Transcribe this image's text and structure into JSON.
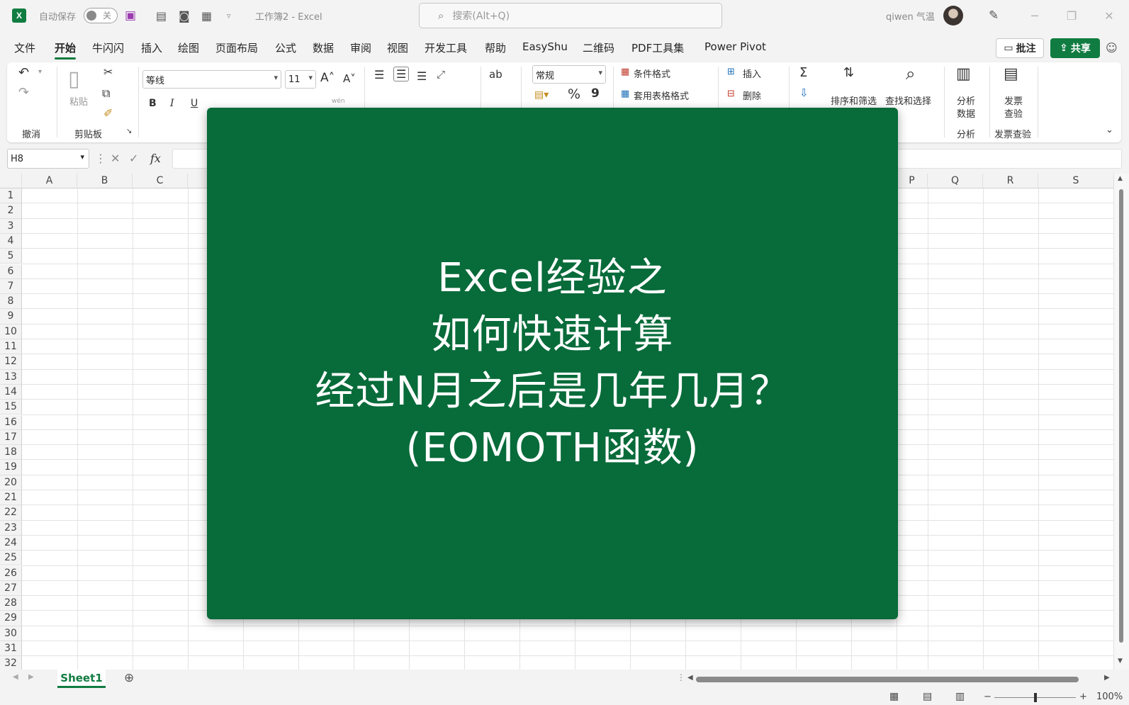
{
  "titlebar": {
    "autosave_label": "自动保存",
    "autosave_state": "关",
    "doc_title": "工作簿2 - Excel",
    "search_placeholder": "搜索(Alt+Q)",
    "user_name": "qiwen 气温",
    "logo_letter": "X"
  },
  "menu": {
    "tabs": [
      "文件",
      "开始",
      "牛闪闪",
      "插入",
      "绘图",
      "页面布局",
      "公式",
      "数据",
      "审阅",
      "视图",
      "开发工具",
      "帮助",
      "EasyShu",
      "二维码",
      "PDF工具集",
      "Power Pivot"
    ],
    "active_tab": "开始",
    "comments_label": "批注",
    "share_label": "共享"
  },
  "ribbon": {
    "undo_group": "撤消",
    "paste_label": "粘贴",
    "clipboard_group": "剪贴板",
    "font_name": "等线",
    "font_size": "11",
    "bold": "B",
    "italic": "I",
    "underline": "U",
    "number_format": "常规",
    "percent": "%",
    "comma": "9",
    "conditional_format": "条件格式",
    "table_format": "套用表格格式",
    "insert_label": "插入",
    "delete_label": "删除",
    "sort_filter": "排序和筛选",
    "find_select": "查找和选择",
    "analyze_data_line1": "分析",
    "analyze_data_line2": "数据",
    "analyze_group": "分析",
    "invoice_line1": "发票",
    "invoice_line2": "查验",
    "invoice_group": "发票查验",
    "phonetic": "wén"
  },
  "formula_bar": {
    "name_box": "H8",
    "fx": "fx",
    "formula": ""
  },
  "grid": {
    "columns_left": [
      "A",
      "B",
      "C"
    ],
    "columns_right": [
      "P",
      "Q",
      "R",
      "S"
    ],
    "rows": [
      "1",
      "2",
      "3",
      "4",
      "5",
      "6",
      "7",
      "8",
      "9",
      "10",
      "11",
      "12",
      "13",
      "14",
      "15",
      "16",
      "17",
      "18",
      "19",
      "20",
      "21",
      "22",
      "23",
      "24",
      "25",
      "26",
      "27",
      "28",
      "29",
      "30",
      "31",
      "32"
    ]
  },
  "overlay": {
    "line1": "Excel经验之",
    "line2": "如何快速计算",
    "line3": "经过N月之后是几年几月？",
    "line4": "(EOMOTH函数)",
    "background": "#086b3a"
  },
  "sheets": {
    "tabs": [
      "Sheet1"
    ],
    "add_symbol": "⊕"
  },
  "status": {
    "zoom": "100%",
    "zoom_minus": "−",
    "zoom_plus": "+"
  },
  "colors": {
    "accent": "#107c41"
  }
}
